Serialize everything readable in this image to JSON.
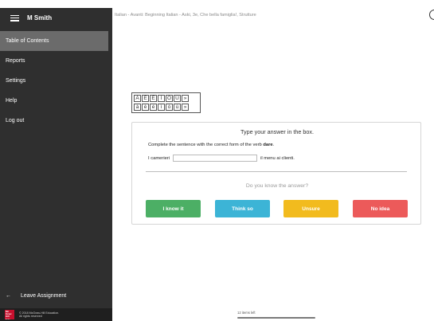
{
  "header": {
    "user_name": "M Smith"
  },
  "sidebar": {
    "items": [
      {
        "label": "Table of Contents",
        "active": true
      },
      {
        "label": "Reports"
      },
      {
        "label": "Settings"
      },
      {
        "label": "Help"
      },
      {
        "label": "Log out"
      }
    ],
    "leave_label": "Leave Assignment",
    "footer": {
      "logo": "Mc Graw Hill Edu",
      "line1": "© 2018 McGraw-Hill Education.",
      "line2": "All rights reserved"
    }
  },
  "breadcrumb": "Italian - Avanti: Beginning Italian - Aski, 3e, Che bella famiglia!, Strutture",
  "keypad": {
    "row1": [
      "À",
      "È",
      "É",
      "Ì",
      "Ò",
      "Ù",
      "»"
    ],
    "row2": [
      "à",
      "è",
      "é",
      "ì",
      "ò",
      "ù",
      "»"
    ]
  },
  "question": {
    "prompt": "Type your answer in the box.",
    "instruction_prefix": "Complete the sentence with the correct form of the verb ",
    "verb": "dare",
    "instruction_suffix": ".",
    "sentence_before": "I camerieri",
    "sentence_after": "il menu ai clienti.",
    "answer_value": "",
    "confidence_question": "Do you know the answer?"
  },
  "buttons": [
    {
      "label": "I know it",
      "color": "#4caf65"
    },
    {
      "label": "Think so",
      "color": "#3cb4d6"
    },
    {
      "label": "Unsure",
      "color": "#f2bb1e"
    },
    {
      "label": "No idea",
      "color": "#ec5a5a"
    }
  ],
  "status": {
    "items_left": "12 items left"
  },
  "colors": {
    "sidebar_bg": "#2f2f2f",
    "active_item_bg": "#6b6b6b"
  }
}
